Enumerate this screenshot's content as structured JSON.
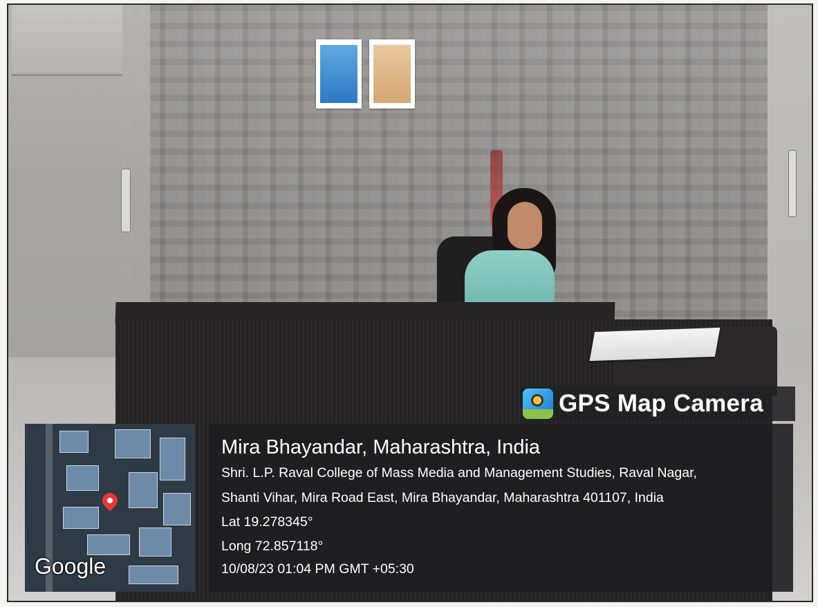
{
  "overlay": {
    "app_name": "GPS Map Camera",
    "app_icon": "gps-map-camera-icon",
    "map_provider": "Google",
    "location_title": "Mira Bhayandar, Maharashtra, India",
    "address_line_1": "Shri. L.P. Raval College of Mass Media and Management Studies, Raval Nagar,",
    "address_line_2": "Shanti Vihar, Mira Road East, Mira Bhayandar, Maharashtra 401107, India",
    "latitude": "Lat 19.278345°",
    "longitude": "Long 72.857118°",
    "datetime": "10/08/23 01:04 PM GMT +05:30"
  },
  "colors": {
    "overlay_bg": "#1e1e20",
    "pin": "#e53935",
    "text": "#ffffff"
  }
}
